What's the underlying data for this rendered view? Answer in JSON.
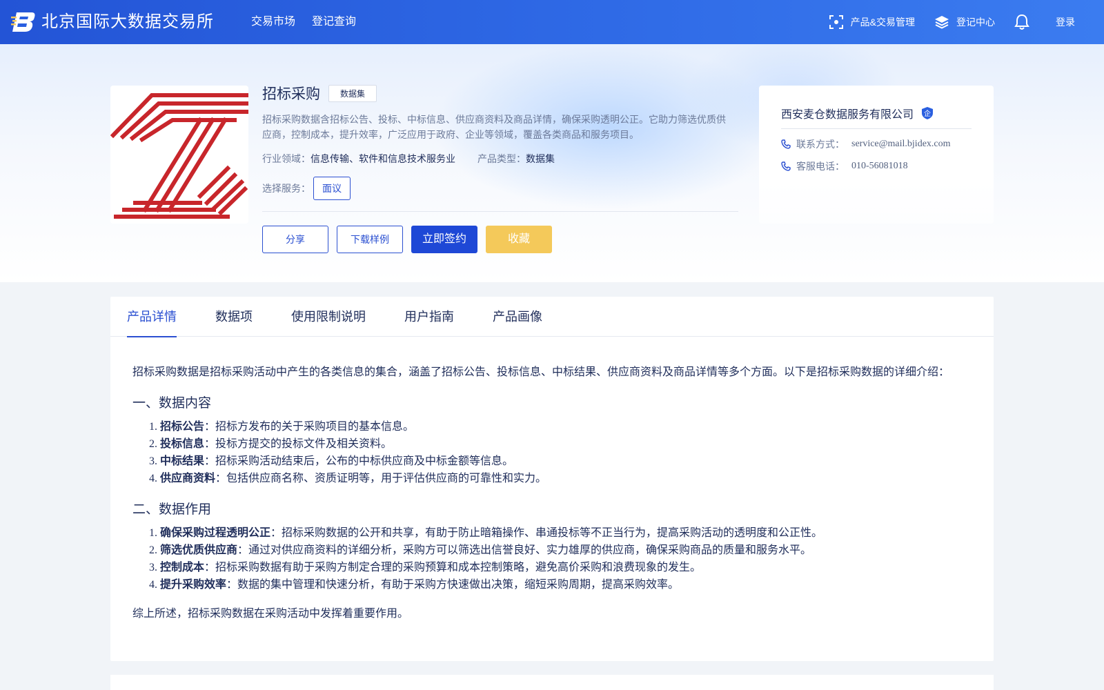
{
  "header": {
    "site_title": "北京国际大数据交易所",
    "nav": [
      "交易市场",
      "登记查询"
    ],
    "product_mgmt": "产品&交易管理",
    "registry_center": "登记中心",
    "login": "登录"
  },
  "product": {
    "title": "招标采购",
    "tag": "数据集",
    "description": "招标采购数据含招标公告、投标、中标信息、供应商资料及商品详情，确保采购透明公正。它助力筛选优质供应商，控制成本，提升效率，广泛应用于政府、企业等领域，覆盖各类商品和服务项目。",
    "industry_label": "行业领域：",
    "industry_value": "信息传输、软件和信息技术服务业",
    "type_label": "产品类型：",
    "type_value": "数据集",
    "service_label": "选择服务：",
    "service_option": "面议",
    "actions": {
      "share": "分享",
      "download_sample": "下载样例",
      "sign": "立即签约",
      "favorite": "收藏"
    }
  },
  "company": {
    "name": "西安麦仓数据服务有限公司",
    "badge": "企",
    "contact_label": "联系方式：",
    "contact_value": "service@mail.bjidex.com",
    "phone_label": "客服电话：",
    "phone_value": "010-56081018"
  },
  "tabs": [
    "产品详情",
    "数据项",
    "使用限制说明",
    "用户指南",
    "产品画像"
  ],
  "active_tab": 0,
  "article": {
    "intro": "招标采购数据是招标采购活动中产生的各类信息的集合，涵盖了招标公告、投标信息、中标结果、供应商资料及商品详情等多个方面。以下是招标采购数据的详细介绍：",
    "section1_title": "一、数据内容",
    "section1_items": [
      {
        "term": "招标公告",
        "text": "：招标方发布的关于采购项目的基本信息。"
      },
      {
        "term": "投标信息",
        "text": "：投标方提交的投标文件及相关资料。"
      },
      {
        "term": "中标结果",
        "text": "：招标采购活动结束后，公布的中标供应商及中标金额等信息。"
      },
      {
        "term": "供应商资料",
        "text": "：包括供应商名称、资质证明等，用于评估供应商的可靠性和实力。"
      }
    ],
    "section2_title": "二、数据作用",
    "section2_items": [
      {
        "term": "确保采购过程透明公正",
        "text": "：招标采购数据的公开和共享，有助于防止暗箱操作、串通投标等不正当行为，提高采购活动的透明度和公正性。"
      },
      {
        "term": "筛选优质供应商",
        "text": "：通过对供应商资料的详细分析，采购方可以筛选出信誉良好、实力雄厚的供应商，确保采购商品的质量和服务水平。"
      },
      {
        "term": "控制成本",
        "text": "：招标采购数据有助于采购方制定合理的采购预算和成本控制策略，避免高价采购和浪费现象的发生。"
      },
      {
        "term": "提升采购效率",
        "text": "：数据的集中管理和快速分析，有助于采购方快速做出决策，缩短采购周期，提高采购效率。"
      }
    ],
    "summary": "综上所述，招标采购数据在采购活动中发挥着重要作用。"
  },
  "colors": {
    "primary": "#1e48d6",
    "accent_yellow": "#f4c95a",
    "logo_red": "#c8262b",
    "text_dark": "#1f2d5a",
    "text_muted": "#6c7a99"
  }
}
